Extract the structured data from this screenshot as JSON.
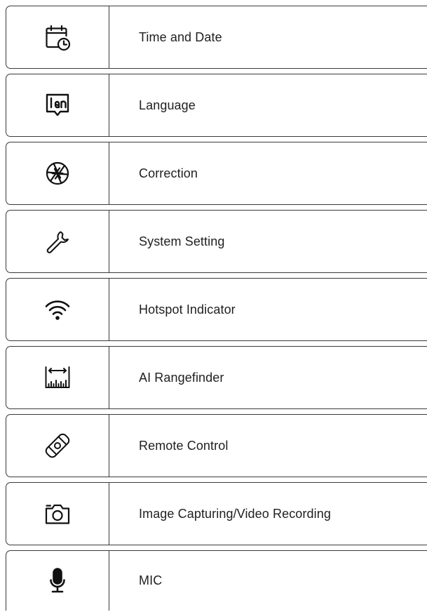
{
  "menu": {
    "items": [
      {
        "label": "Time and Date",
        "icon": "calendar-clock-icon"
      },
      {
        "label": "Language",
        "icon": "language-lan-icon"
      },
      {
        "label": "Correction",
        "icon": "aperture-icon"
      },
      {
        "label": "System Setting",
        "icon": "wrench-icon"
      },
      {
        "label": "Hotspot Indicator",
        "icon": "wifi-hotspot-icon"
      },
      {
        "label": "AI Rangefinder",
        "icon": "rangefinder-ruler-icon"
      },
      {
        "label": "Remote Control",
        "icon": "remote-control-icon"
      },
      {
        "label": "Image Capturing/Video Recording",
        "icon": "camera-icon"
      },
      {
        "label": "MIC",
        "icon": "microphone-icon"
      }
    ]
  },
  "colors": {
    "border": "#3a3a3a",
    "text": "#1f1f1f",
    "icon": "#111111"
  }
}
